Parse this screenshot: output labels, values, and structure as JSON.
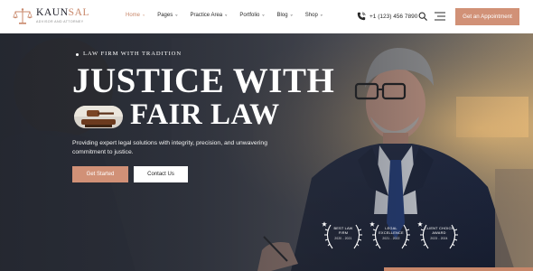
{
  "brand": {
    "name_part1": "KAUN",
    "name_part2": "SAL",
    "tagline": "ADVISOR AND ATTORNEY"
  },
  "nav": {
    "items": [
      {
        "label": "Home",
        "active": true,
        "has_dropdown": true
      },
      {
        "label": "Pages",
        "active": false,
        "has_dropdown": true
      },
      {
        "label": "Practice Area",
        "active": false,
        "has_dropdown": true
      },
      {
        "label": "Portfolio",
        "active": false,
        "has_dropdown": true
      },
      {
        "label": "Blog",
        "active": false,
        "has_dropdown": true
      },
      {
        "label": "Shop",
        "active": false,
        "has_dropdown": true
      }
    ]
  },
  "header": {
    "phone": "+1 (123) 456 7890",
    "cta_label": "Get an Appointment",
    "icons": [
      "phone-icon",
      "search-icon",
      "menu-icon"
    ]
  },
  "hero": {
    "eyebrow": "LAW FIRM WITH TRADITION",
    "headline_line1": "JUSTICE WITH",
    "headline_line2": "FAIR LAW",
    "description": "Providing expert legal solutions with integrity, precision, and unwavering commitment to justice.",
    "primary_button": "Get Started",
    "secondary_button": "Contact Us",
    "awards": [
      {
        "title_line1": "BEST LAW",
        "title_line2": "FIRM",
        "years": "2020 - 2021"
      },
      {
        "title_line1": "LEGAL",
        "title_line2": "EXCELLENCE",
        "years": "2021 - 2022"
      },
      {
        "title_line1": "CLIENT CHOICE",
        "title_line2": "AWARD",
        "years": "2023 - 2024"
      }
    ]
  },
  "colors": {
    "accent": "#d19177",
    "text_dark": "#2a2a2a",
    "white": "#ffffff",
    "hero_dark": "#2d313b"
  }
}
